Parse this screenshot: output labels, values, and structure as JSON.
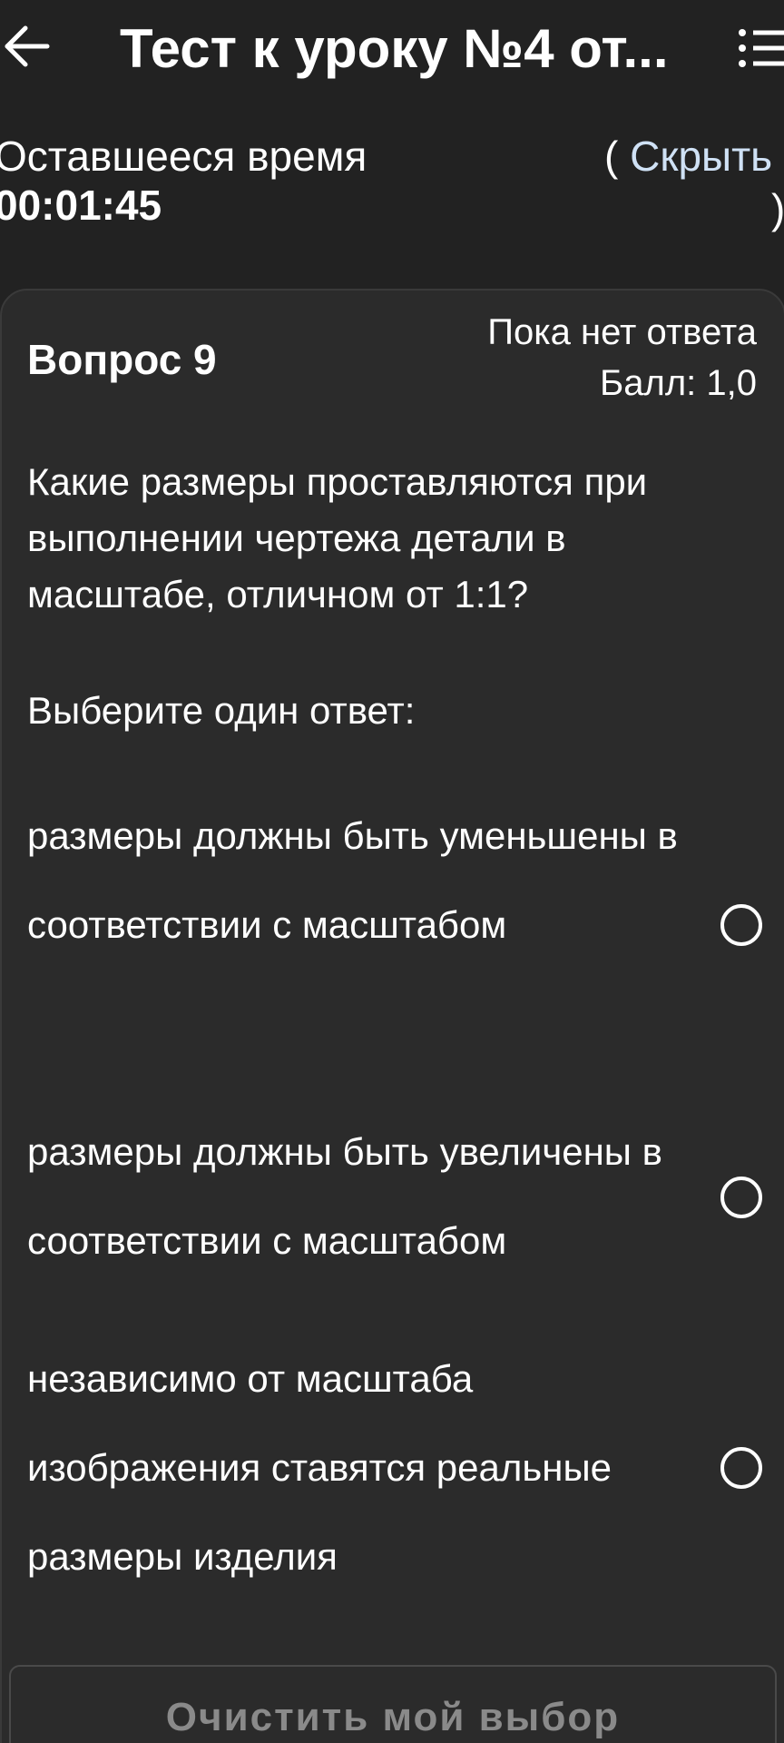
{
  "header": {
    "title": "Тест к уроку №4 от...",
    "back_icon": "arrow-left-icon",
    "menu_icon": "list-menu-icon"
  },
  "timer": {
    "label": "Оставшееся время",
    "value": "00:01:45",
    "toggle_open": "( ",
    "toggle_link": "Скрыть",
    "toggle_close": ")"
  },
  "question": {
    "title": "Вопрос 9",
    "status": "Пока нет ответа",
    "score": "Балл: 1,0",
    "text": "Какие размеры проставляются при выполнении чертежа  детали в масштабе, отличном от 1:1?",
    "prompt": "Выберите один ответ:",
    "options": [
      {
        "label": "размеры должны быть уменьшены в соответствии с масштабом"
      },
      {
        "label": "размеры должны быть увеличены в соответствии с масштабом"
      },
      {
        "label": "независимо от масштаба изображения ставятся реальные размеры изделия"
      }
    ],
    "clear_label": "Очистить мой выбор"
  },
  "colors": {
    "background": "#222222",
    "card": "#2b2b2b",
    "link": "#cfe1f5",
    "disabled_text": "#8a8a8a"
  }
}
